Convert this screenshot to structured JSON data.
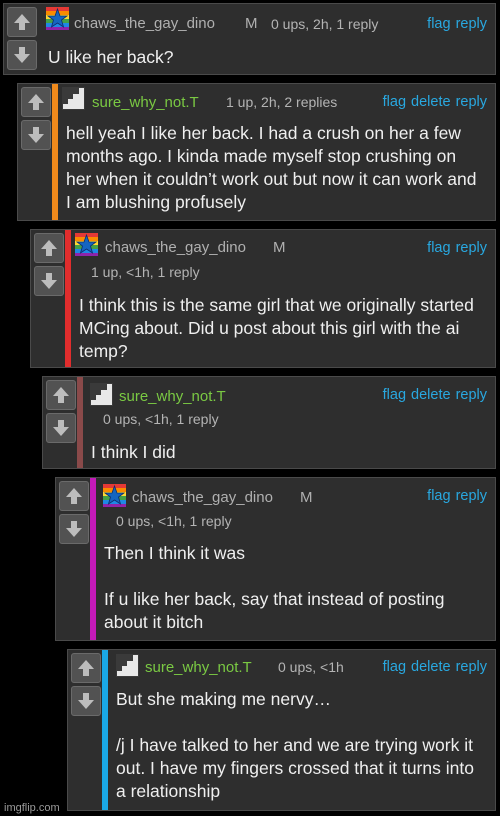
{
  "icons": {
    "upvote": "arrow-up-icon",
    "downvote": "arrow-down-icon"
  },
  "colors": {
    "background": "#000000",
    "card": "#2e2e2e",
    "link": "#29a8e0",
    "username_green": "#7ac943",
    "bars": [
      "#f08a1c",
      "#e12d2d",
      "#8a4a4a",
      "#c41ab8",
      "#1aa8e6"
    ]
  },
  "comments": [
    {
      "username": "chaws_the_gay_dino",
      "badge": "M",
      "meta": "0 ups, 2h, 1 reply",
      "actions": [
        "flag",
        "reply"
      ],
      "text": [
        "U like her back?"
      ]
    },
    {
      "username": "sure_why_not.T",
      "meta": "1 up, 2h, 2 replies",
      "actions": [
        "flag",
        "delete",
        "reply"
      ],
      "text": [
        "hell yeah I like her back. I had a crush on her a few months ago. I kinda made myself stop crushing on her when it couldn’t work out but now it can work and I am blushing profusely"
      ]
    },
    {
      "username": "chaws_the_gay_dino",
      "badge": "M",
      "meta": "1 up, <1h, 1 reply",
      "actions": [
        "flag",
        "reply"
      ],
      "text": [
        "I think this is the same girl that we originally started MCing about. Did u post about this girl with the ai temp?"
      ]
    },
    {
      "username": "sure_why_not.T",
      "meta": "0 ups, <1h, 1 reply",
      "actions": [
        "flag",
        "delete",
        "reply"
      ],
      "text": [
        "I think I did"
      ]
    },
    {
      "username": "chaws_the_gay_dino",
      "badge": "M",
      "meta": "0 ups, <1h, 1 reply",
      "actions": [
        "flag",
        "reply"
      ],
      "text": [
        "Then I think it was",
        "If u like her back, say that instead of posting about it bitch"
      ]
    },
    {
      "username": "sure_why_not.T",
      "meta": "0 ups, <1h",
      "actions": [
        "flag",
        "delete",
        "reply"
      ],
      "text": [
        "But she making me nervy…",
        "/j I have talked to her and we are trying work it out. I have my fingers crossed that it turns into a relationship"
      ]
    }
  ],
  "watermark": "imgflip.com"
}
